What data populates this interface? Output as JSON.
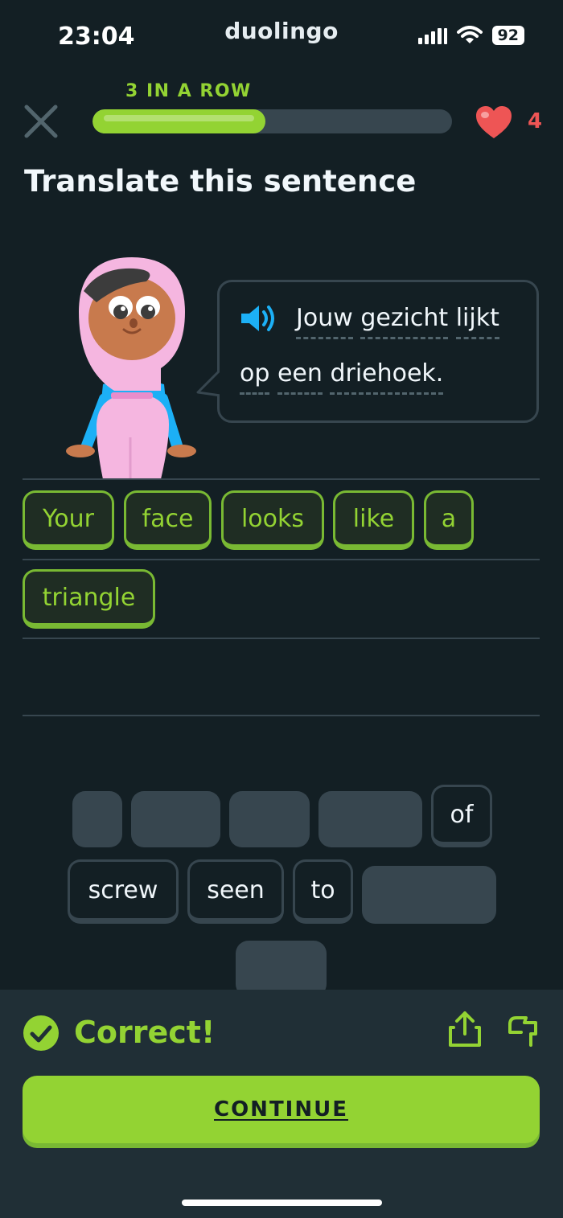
{
  "status_bar": {
    "time": "23:04",
    "app_name": "duolingo",
    "battery": "92",
    "icons": [
      "signal-icon",
      "wifi-icon",
      "battery-icon"
    ]
  },
  "lesson": {
    "streak_label": "3 IN A ROW",
    "progress_fraction": 0.48,
    "hearts": "4",
    "prompt": "Translate this sentence"
  },
  "sentence": {
    "line1": [
      "Jouw",
      "gezicht",
      "lijkt"
    ],
    "line2": [
      "op",
      "een",
      "driehoek."
    ]
  },
  "answer_words": [
    "Your",
    "face",
    "looks",
    "like",
    "a",
    "triangle"
  ],
  "word_bank": {
    "visible_words": [
      "of",
      "screw",
      "seen",
      "to"
    ]
  },
  "feedback": {
    "result": "Correct!",
    "continue_label": "CONTINUE"
  },
  "colors": {
    "background": "#131f24",
    "accent_green": "#93d333",
    "heart_red": "#ee5555",
    "border_gray": "#37464f",
    "footer": "#202f36"
  }
}
